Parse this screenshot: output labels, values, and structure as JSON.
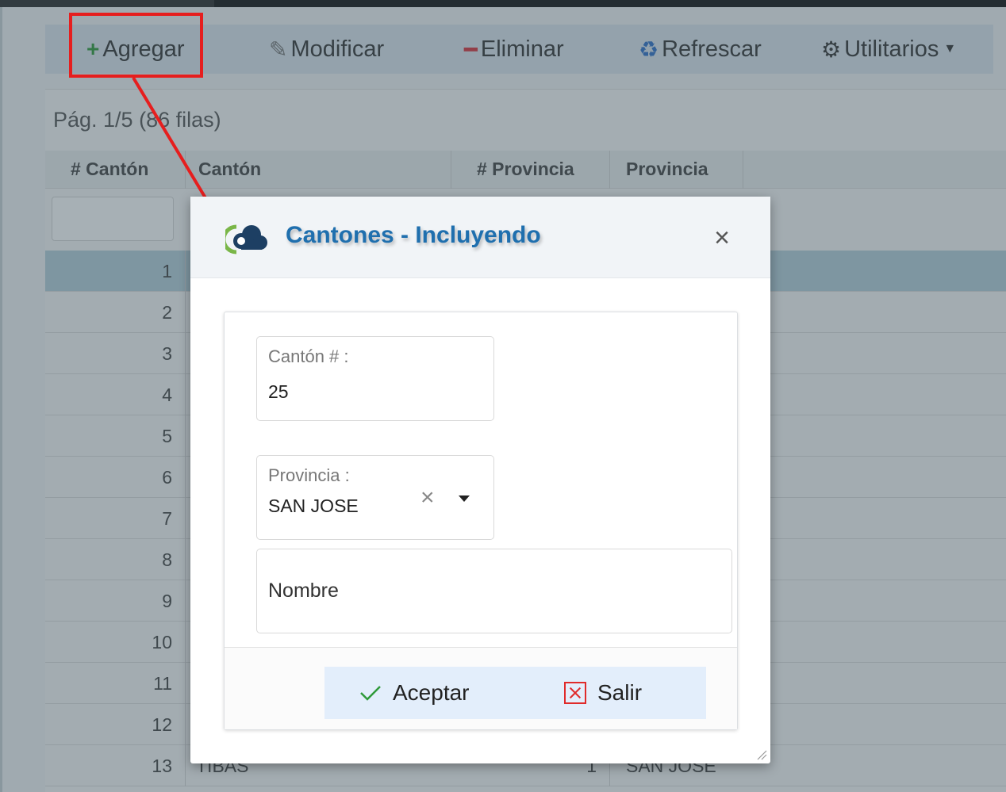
{
  "toolbar": {
    "add_label": "Agregar",
    "edit_label": "Modificar",
    "delete_label": "Eliminar",
    "refresh_label": "Refrescar",
    "utilities_label": "Utilitarios"
  },
  "grid": {
    "pager": "Pág. 1/5 (86 filas)",
    "columns": [
      "# Cantón",
      "Cantón",
      "# Provincia",
      "Provincia"
    ],
    "rows": [
      {
        "num": "1"
      },
      {
        "num": "2"
      },
      {
        "num": "3"
      },
      {
        "num": "4"
      },
      {
        "num": "5"
      },
      {
        "num": "6"
      },
      {
        "num": "7"
      },
      {
        "num": "8"
      },
      {
        "num": "9"
      },
      {
        "num": "10"
      },
      {
        "num": "11"
      },
      {
        "num": "12"
      },
      {
        "num": "13",
        "name": "TIBAS",
        "pnum": "1",
        "pname": "SAN JOSE"
      }
    ]
  },
  "modal": {
    "title": "Cantones - Incluyendo",
    "canton_label": "Cantón # :",
    "canton_value": "25",
    "provincia_label": "Provincia :",
    "provincia_value": "SAN JOSE",
    "nombre_placeholder": "Nombre",
    "accept_label": "Aceptar",
    "exit_label": "Salir"
  },
  "colors": {
    "title": "#1f6fae",
    "highlight": "#e61e1e",
    "accept_check": "#2f9a3a",
    "exit_icon": "#e02a2a"
  }
}
